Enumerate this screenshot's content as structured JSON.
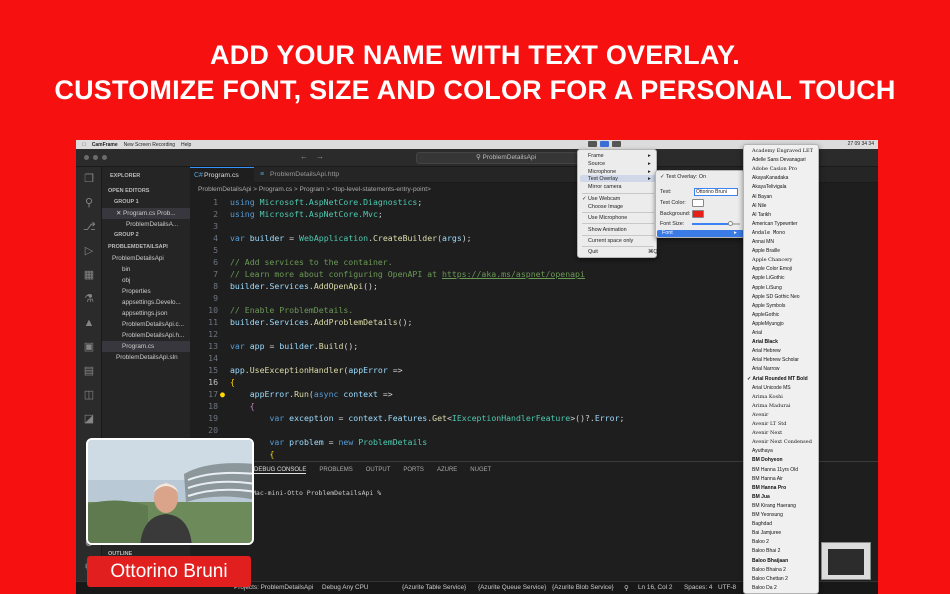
{
  "headline": {
    "line1": "ADD YOUR NAME WITH TEXT OVERLAY.",
    "line2": "CUSTOMIZE FONT, SIZE AND COLOR FOR A PERSONAL TOUCH"
  },
  "menubar": {
    "app": "CamFrame",
    "items": [
      "New Screen Recording",
      "Help"
    ],
    "clock": "27 09 34 34"
  },
  "titlebar": {
    "search": "ProblemDetailsApi"
  },
  "sidebar": {
    "title": "EXPLORER",
    "open_editors": "OPEN EDITORS",
    "group1": "GROUP 1",
    "group1_files": [
      "Program.cs  Prob...",
      "ProblemDetailsA..."
    ],
    "group2": "GROUP 2",
    "project": "PROBLEMDETAILSAPI",
    "tree": [
      "ProblemDetailsApi",
      "bin",
      "obj",
      "Properties",
      "appsettings.Develo...",
      "appsettings.json",
      "ProblemDetailsApi.c...",
      "ProblemDetailsApi.h...",
      "Program.cs",
      "ProblemDetailsApi.sln"
    ],
    "outline": "OUTLINE"
  },
  "tabs": [
    {
      "label": "Program.cs"
    },
    {
      "label": "ProblemDetailsApi.http"
    }
  ],
  "breadcrumb": "ProblemDetailsApi  >  Program.cs  >  Program  >  <top-level-statements-entry-point>",
  "code": {
    "line_numbers": [
      "1",
      "2",
      "3",
      "4",
      "5",
      "6",
      "7",
      "8",
      "9",
      "10",
      "11",
      "12",
      "13",
      "14",
      "15",
      "16",
      "17",
      "18",
      "19",
      "20",
      "21"
    ],
    "current_line": "16"
  },
  "panel": {
    "tabs": [
      "DEBUG CONSOLE",
      "PROBLEMS",
      "OUTPUT",
      "PORTS",
      "AZURE",
      "NUGET"
    ],
    "prompt": "Mac-mini-Otto ProblemDetailsApi %"
  },
  "statusbar": {
    "items": [
      "Projects: ProblemDetailsApi",
      "Debug Any CPU",
      "{Azurite Table Service}",
      "{Azurite Queue Service}",
      "{Azurite Blob Service}",
      "Ln 16, Col 2",
      "Spaces: 4",
      "UTF-8"
    ]
  },
  "menu1": {
    "items": [
      "Frame",
      "Source",
      "Microphone",
      "Text Overlay",
      "Mirror camera",
      "Use Webcam",
      "Choose Image",
      "Use Microphone",
      "Show Animation",
      "Current space only",
      "Quit"
    ],
    "quit_shortcut": "⌘Q"
  },
  "menu2": {
    "toggle": "Text Overlay: On",
    "text_label": "Text:",
    "text_value": "Ottorino Bruni",
    "text_color_label": "Text Color:",
    "background_label": "Background:",
    "font_size_label": "Font Size:",
    "font_label": "Font",
    "text_color": "#ffffff",
    "background_color": "#e5201a"
  },
  "fontlist": [
    "Academy Engraved LET",
    "Adelle Sans Devanagari",
    "Adobe Caslon Pro",
    "AkayaKanadaka",
    "AkayaTelivigala",
    "Al Bayan",
    "Al Nile",
    "Al Tarikh",
    "American Typewriter",
    "Andale Mono",
    "Annai MN",
    "Apple Braille",
    "Apple Chancery",
    "Apple Color Emoji",
    "Apple LiGothic",
    "Apple LiSung",
    "Apple SD Gothic Neo",
    "Apple Symbols",
    "AppleGothic",
    "AppleMyungjo",
    "Arial",
    "Arial Black",
    "Arial Hebrew",
    "Arial Hebrew Scholar",
    "Arial Narrow",
    "Arial Rounded MT Bold",
    "Arial Unicode MS",
    "Arima Koshi",
    "Arima Madurai",
    "Avenir",
    "Avenir LT Std",
    "Avenir Next",
    "Avenir Next Condensed",
    "Ayuthaya",
    "BM Dohyeon",
    "BM Hanna 11yrs Old",
    "BM Hanna Air",
    "BM Hanna Pro",
    "BM Jua",
    "BM Kirang Haerang",
    "BM Yeonsung",
    "Baghdad",
    "Bai Jamjuree",
    "Baloo 2",
    "Baloo Bhai 2",
    "Baloo Bhaijaan",
    "Baloo Bhaina 2",
    "Baloo Chettan 2",
    "Baloo Da 2"
  ],
  "font_selected": "Arial Rounded MT Bold",
  "overlay_name": "Ottorino Bruni"
}
